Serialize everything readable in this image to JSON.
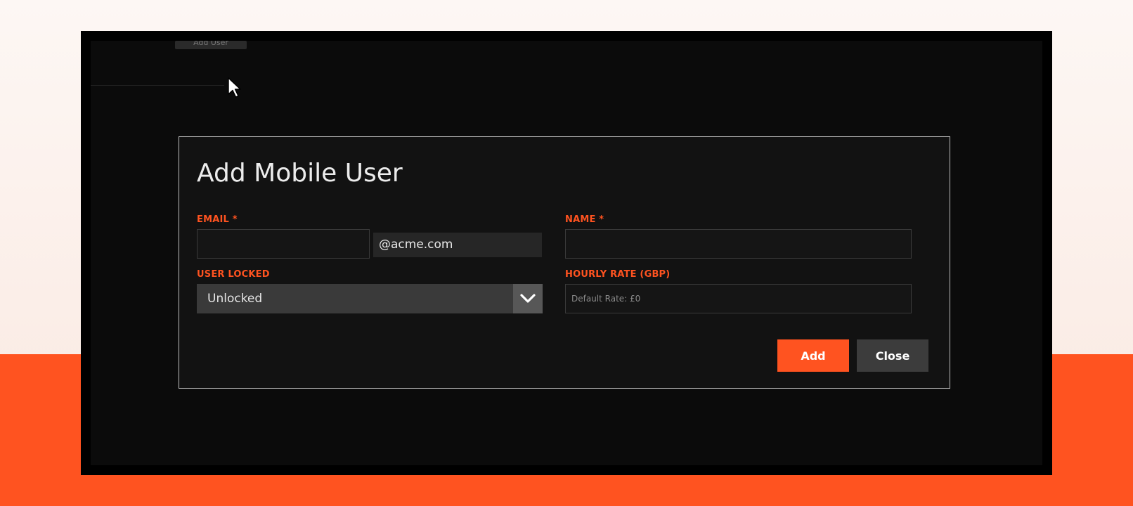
{
  "background_page": {
    "add_user_button": "Add User"
  },
  "modal": {
    "title": "Add Mobile User",
    "email": {
      "label": "EMAIL *",
      "value": "",
      "domain_suffix": "@acme.com"
    },
    "name": {
      "label": "NAME *",
      "value": ""
    },
    "user_locked": {
      "label": "USER LOCKED",
      "selected": "Unlocked"
    },
    "hourly_rate": {
      "label": "HOURLY RATE (GBP)",
      "value": "",
      "placeholder": "Default Rate: £0"
    },
    "buttons": {
      "add": "Add",
      "close": "Close"
    }
  },
  "colors": {
    "accent": "#ff5320",
    "modal_bg": "#121212",
    "app_bg": "#0b0b0b",
    "modal_border": "#bfbfbf"
  },
  "icons": {
    "select_arrow": "chevron-down-icon",
    "cursor": "mouse-pointer-icon"
  }
}
